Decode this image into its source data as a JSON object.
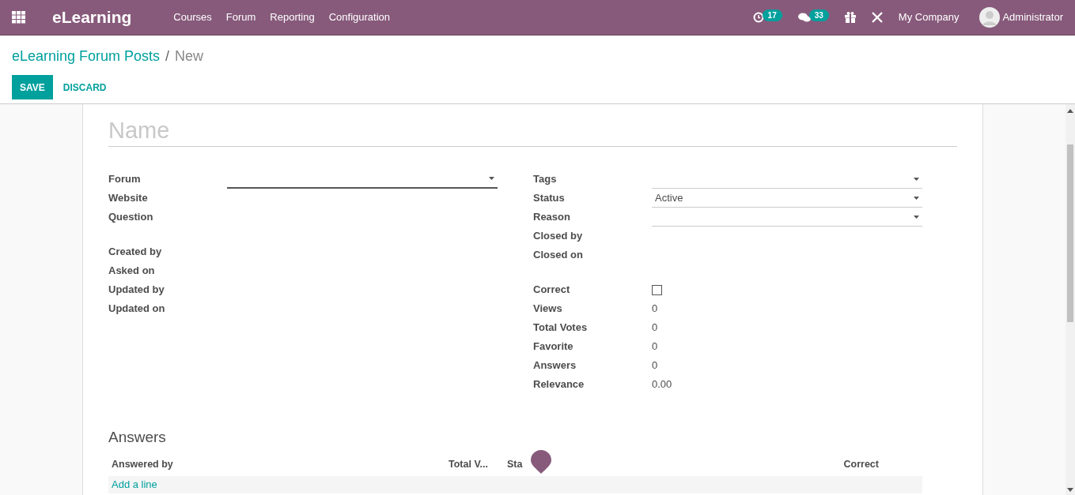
{
  "navbar": {
    "app_name": "eLearning",
    "menu": [
      "Courses",
      "Forum",
      "Reporting",
      "Configuration"
    ],
    "activity_count": "17",
    "message_count": "33",
    "company": "My Company",
    "user": "Administrator"
  },
  "breadcrumb": {
    "parent": "eLearning Forum Posts",
    "separator": "/",
    "current": "New"
  },
  "actions": {
    "save": "SAVE",
    "discard": "DISCARD"
  },
  "form": {
    "title_placeholder": "Name",
    "left_groups": [
      [
        {
          "label": "Forum",
          "kind": "dropdown",
          "focused": true
        },
        {
          "label": "Website",
          "kind": "text"
        },
        {
          "label": "Question",
          "kind": "text"
        }
      ],
      [
        {
          "label": "Created by",
          "kind": "text"
        },
        {
          "label": "Asked on",
          "kind": "text"
        },
        {
          "label": "Updated by",
          "kind": "text"
        },
        {
          "label": "Updated on",
          "kind": "text"
        }
      ]
    ],
    "right_groups": [
      [
        {
          "label": "Tags",
          "kind": "dropdown",
          "focused": false
        },
        {
          "label": "Status",
          "kind": "dropdown",
          "focused": false,
          "value": "Active"
        },
        {
          "label": "Reason",
          "kind": "dropdown",
          "focused": false
        },
        {
          "label": "Closed by",
          "kind": "text"
        },
        {
          "label": "Closed on",
          "kind": "text"
        }
      ],
      [
        {
          "label": "Correct",
          "kind": "checkbox",
          "checked": false
        },
        {
          "label": "Views",
          "kind": "text",
          "value": "0"
        },
        {
          "label": "Total Votes",
          "kind": "text",
          "value": "0"
        },
        {
          "label": "Favorite",
          "kind": "text",
          "value": "0"
        },
        {
          "label": "Answers",
          "kind": "text",
          "value": "0"
        },
        {
          "label": "Relevance",
          "kind": "text",
          "value": "0.00"
        }
      ]
    ]
  },
  "answers": {
    "heading": "Answers",
    "columns": [
      "Answered by",
      "Total V...",
      "Sta",
      "Correct"
    ],
    "add_line": "Add a line"
  }
}
